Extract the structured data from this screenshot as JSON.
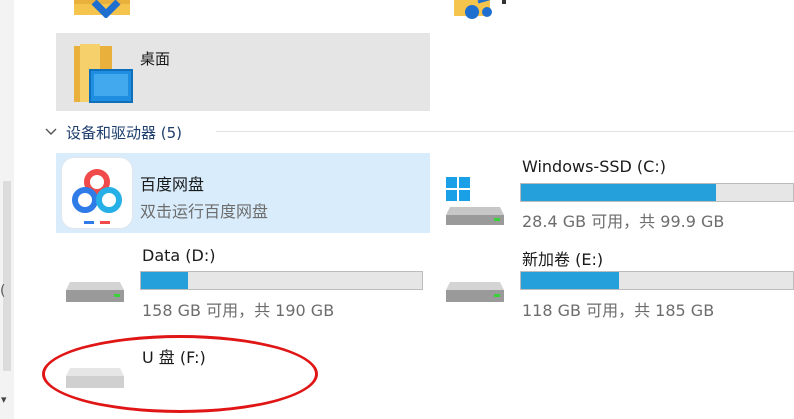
{
  "top_items": [
    {
      "icon": "folder-icon"
    },
    {
      "icon": "music-folder-icon"
    }
  ],
  "desktop": {
    "label": "桌面",
    "icon": "desktop-folder-icon"
  },
  "section": {
    "title": "设备和驱动器 (5)",
    "icon": "chevron-down-icon"
  },
  "baidu": {
    "name": "百度网盘",
    "subtitle": "双击运行百度网盘",
    "icon": "baidu-netdisk-icon"
  },
  "drives": [
    {
      "name": "Windows-SSD (C:)",
      "info": "28.4 GB 可用，共 99.9 GB",
      "used_fraction": 0.716,
      "icon": "windows-drive-icon"
    },
    {
      "name": "Data (D:)",
      "info": "158 GB 可用，共 190 GB",
      "used_fraction": 0.168,
      "icon": "hard-drive-icon"
    },
    {
      "name": "新加卷 (E:)",
      "info": "118 GB 可用，共 185 GB",
      "used_fraction": 0.362,
      "icon": "hard-drive-icon"
    },
    {
      "name": "U 盘 (F:)",
      "icon": "usb-drive-icon"
    }
  ],
  "colors": {
    "bar_fill": "#26a0da",
    "selection": "#d8ecfb",
    "highlight_oval": "#e01515"
  }
}
